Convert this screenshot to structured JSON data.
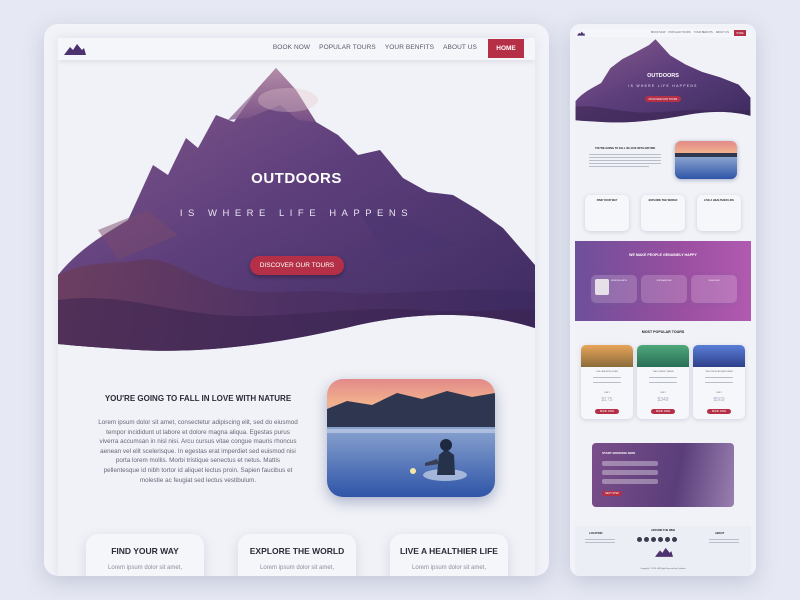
{
  "main": {
    "nav": {
      "links": [
        "BOOK NOW",
        "POPULAR TOURS",
        "YOUR BENFITS",
        "ABOUT US"
      ],
      "home": "HOME"
    },
    "hero": {
      "title": "OUTDOORS",
      "subtitle": "IS WHERE LIFE HAPPENS",
      "cta": "DISCOVER OUR TOURS"
    },
    "intro": {
      "title": "YOU'RE GOING TO FALL IN LOVE WITH NATURE",
      "body": "Lorem ipsum dolor sit amet, consectetur adipiscing elit, sed do eiusmod tempor incididunt ut labore et dolore magna aliqua. Egestas purus viverra accumsan in nisl nisi. Arcu cursus vitae congue mauris rhoncus aenean vel elit scelerisque. In egestas erat imperdiet sed euismod nisi porta lorem mollis. Morbi tristique senectus et netus. Mattis pellentesque id nibh tortor id aliquet lectus proin. Sapien faucibus et molestie ac feugiat sed lectus vestibulum."
    },
    "features": [
      {
        "title": "FIND YOUR WAY",
        "desc": "Lorem ipsum dolor sit amet,"
      },
      {
        "title": "EXPLORE THE WORLD",
        "desc": "Lorem ipsum dolor sit amet,"
      },
      {
        "title": "LIVE A HEALTHIER LIFE",
        "desc": "Lorem ipsum dolor sit amet,"
      }
    ]
  },
  "mini": {
    "nav": {
      "links": [
        "BOOK NOW",
        "POPULAR TOURS",
        "YOUR BENFITS",
        "ABOUT US"
      ],
      "home": "HOME"
    },
    "hero": {
      "title": "OUTDOORS",
      "subtitle": "IS WHERE LIFE HAPPENS",
      "cta": "DISCOVER OUR TOURS"
    },
    "intro_title": "YOU'RE GOING TO FALL IN LOVE WITH NATURE",
    "features": [
      "FIND YOUR WAY",
      "EXPLORE THE WORLD",
      "LIVE A HEALTHIER LIFE"
    ],
    "testimonial_title": "WE MAKE PEOPLE GENUINELY HAPPY",
    "testimonials": [
      "MONICA SMITH",
      "SOPHIA ROSE",
      "JOHN DOE"
    ],
    "tours_title": "MOST POPULAR TOURS",
    "tours": [
      {
        "name": "THE SEA EXPLORER",
        "price_label": "ONLY",
        "price": "$175",
        "button": "BOOK NOW"
      },
      {
        "name": "THE FOREST HIKER",
        "price_label": "ONLY",
        "price": "$349",
        "button": "BOOK NOW"
      },
      {
        "name": "THE SNOW ADVENTURER",
        "price_label": "ONLY",
        "price": "$569",
        "button": "BOOK NOW"
      }
    ],
    "booking": {
      "title": "START BOOKING NOW",
      "button": "NEXT STEP"
    },
    "footer": {
      "location": "LOCATION",
      "around": "AROUND THE WEB",
      "about": "ABOUT",
      "copyright": "Copyright © 2018 - All Right Reserved by Outdoors"
    }
  },
  "colors": {
    "accent": "#b53047",
    "hero_purple": "#6b4a8a",
    "background": "#e6e9f3"
  },
  "icons": [
    "mountain-logo-icon"
  ]
}
